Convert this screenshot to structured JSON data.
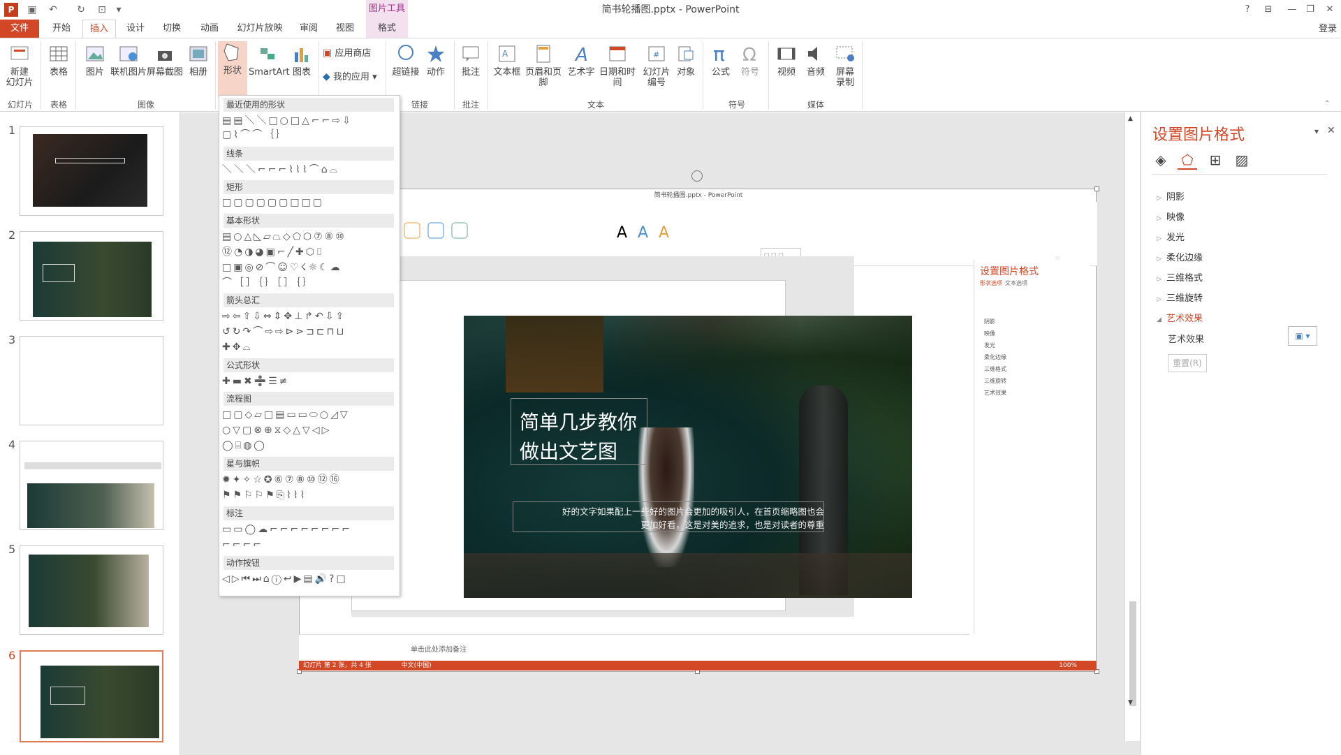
{
  "window": {
    "title": "简书轮播图.pptx - PowerPoint",
    "context_group": "图片工具",
    "login": "登录"
  },
  "tabs": [
    "文件",
    "开始",
    "插入",
    "设计",
    "切换",
    "动画",
    "幻灯片放映",
    "审阅",
    "视图",
    "格式"
  ],
  "ribbon": {
    "buttons": {
      "new_slide": "新建\n幻灯片",
      "table": "表格",
      "picture": "图片",
      "online_picture": "联机图片",
      "screenshot": "屏幕截图",
      "album": "相册",
      "shapes": "形状",
      "smartart": "SmartArt",
      "chart": "图表",
      "store": "应用商店",
      "my_apps": "我的应用",
      "hyperlink": "超链接",
      "action": "动作",
      "comment": "批注",
      "textbox": "文本框",
      "header_footer": "页眉和页脚",
      "wordart": "艺术字",
      "datetime": "日期和时间",
      "slide_number": "幻灯片\n编号",
      "object": "对象",
      "equation": "公式",
      "symbol": "符号",
      "video": "视频",
      "audio": "音频",
      "screen_record": "屏幕\n录制"
    },
    "groups": {
      "slides": "幻灯片",
      "tables": "表格",
      "images": "图像",
      "links": "链接",
      "comments": "批注",
      "text": "文本",
      "symbols": "符号",
      "media": "媒体"
    }
  },
  "shapes_menu": {
    "sections": [
      "最近使用的形状",
      "线条",
      "矩形",
      "基本形状",
      "箭头总汇",
      "公式形状",
      "流程图",
      "星与旗帜",
      "标注",
      "动作按钮"
    ]
  },
  "slides": {
    "numbers": [
      "1",
      "2",
      "3",
      "4",
      "5",
      "6"
    ],
    "selected": 6
  },
  "slide_content": {
    "headline_1": "简单几步教你",
    "headline_2": "做出文艺图",
    "body_1": "好的文字如果配上一些好的图片会更加的吸引人，在首页缩略图也会",
    "body_2": "更加好看，这是对美的追求，也是对读者的尊重"
  },
  "inner_window": {
    "title": "简书轮播图.pptx - PowerPoint",
    "notes_placeholder": "单击此处添加备注",
    "status_left": "幻灯片 第 2 张，共 4 张",
    "lang": "中文(中国)",
    "zoom": "100%",
    "pane_title": "设置图片格式",
    "pane_tabs": [
      "形状选项",
      "文本选项"
    ],
    "pane_items": [
      "阴影",
      "映像",
      "发光",
      "柔化边缘",
      "三维格式",
      "三维旋转",
      "艺术效果"
    ]
  },
  "format_pane": {
    "title": "设置图片格式",
    "items": [
      "阴影",
      "映像",
      "发光",
      "柔化边缘",
      "三维格式",
      "三维旋转",
      "艺术效果"
    ],
    "expanded": "艺术效果",
    "art_effect_label": "艺术效果",
    "reset_label": "重置(R)"
  }
}
